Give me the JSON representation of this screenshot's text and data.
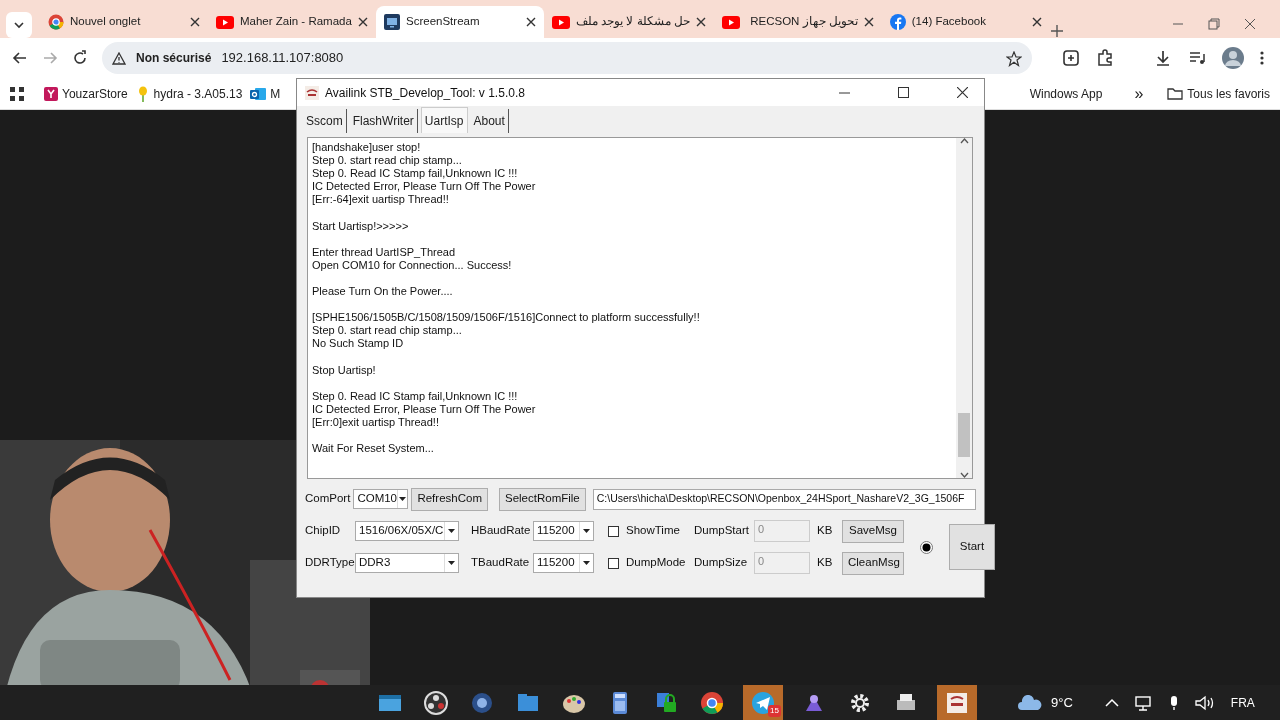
{
  "browser": {
    "tabs": [
      {
        "title": "Nouvel onglet",
        "kind": "chrome",
        "selected": false
      },
      {
        "title": "Maher Zain - Ramada",
        "kind": "youtube",
        "selected": false
      },
      {
        "title": "ScreenStream",
        "kind": "stream",
        "selected": true
      },
      {
        "title": "حل مشكلة لا يوجد ملف",
        "kind": "youtube",
        "selected": false
      },
      {
        "title": "تحويل جهاز RECSON",
        "kind": "youtube",
        "selected": false
      },
      {
        "title": "(14) Facebook",
        "kind": "facebook",
        "selected": false
      }
    ],
    "security": "Non sécurisé",
    "url": "192.168.11.107:8080",
    "bookmarks": [
      {
        "label": "YouzarStore",
        "kind": "y"
      },
      {
        "label": "hydra - 3.A05.13",
        "kind": "plant"
      },
      {
        "label": "M",
        "kind": "outlook"
      },
      {
        "label": "Windows App",
        "kind": "none"
      }
    ],
    "more": "»",
    "all_bookmarks": "Tous les favoris"
  },
  "app": {
    "title": "Availink STB_Develop_Tool: v 1.5.0.8",
    "tabs": [
      {
        "label": "Sscom",
        "selected": false
      },
      {
        "label": "FlashWriter",
        "selected": false
      },
      {
        "label": "UartIsp",
        "selected": true
      },
      {
        "label": "About",
        "selected": false
      }
    ],
    "log": [
      [
        "[handshake]user stop!",
        "Step 0. start read chip stamp...",
        "Step 0. Read IC Stamp fail,Unknown IC !!!",
        "IC Detected Error, Please Turn Off The Power",
        "[Err:-64]exit uartisp Thread!!"
      ],
      [
        "Start Uartisp!>>>>>"
      ],
      [
        "Enter thread UartISP_Thread",
        "Open COM10 for Connection... Success!"
      ],
      [
        "Please Turn On the Power...."
      ],
      [
        "[SPHE1506/1505B/C/1508/1509/1506F/1516]Connect to platform successfully!!",
        "Step 0. start read chip stamp...",
        "No Such Stamp ID"
      ],
      [
        "Stop Uartisp!"
      ],
      [
        "Step 0. Read IC Stamp fail,Unknown IC !!!",
        "IC Detected Error, Please Turn Off The Power",
        "[Err:0]exit uartisp Thread!!"
      ],
      [
        "Wait For Reset System..."
      ]
    ],
    "comport": {
      "label": "ComPort",
      "value": "COM10"
    },
    "refresh": "RefreshCom",
    "select_rom": "SelectRomFile",
    "rom_path": "C:\\Users\\hicha\\Desktop\\RECSON\\Openbox_24HSport_NashareV2_3G_1506F",
    "chip_id": {
      "label": "ChipID",
      "value": "1516/06X/05X/C"
    },
    "ddr_type": {
      "label": "DDRType",
      "value": "DDR3"
    },
    "hbaud": {
      "label": "HBaudRate",
      "value": "115200"
    },
    "tbaud": {
      "label": "TBaudRate",
      "value": "115200"
    },
    "show_time": {
      "label": "ShowTime",
      "checked": false
    },
    "dump_mode": {
      "label": "DumpMode",
      "checked": false
    },
    "dump_start": {
      "label": "DumpStart",
      "value": "0",
      "unit": "KB",
      "disabled": true
    },
    "dump_size": {
      "label": "DumpSize",
      "value": "0",
      "unit": "KB",
      "disabled": true
    },
    "save": "SaveMsg",
    "clean": "CleanMsg",
    "indicator": {
      "checked": true
    },
    "start": "Start"
  },
  "taskbar": {
    "telegram_badge": "15",
    "weather": "9°C",
    "language": "FRA"
  }
}
